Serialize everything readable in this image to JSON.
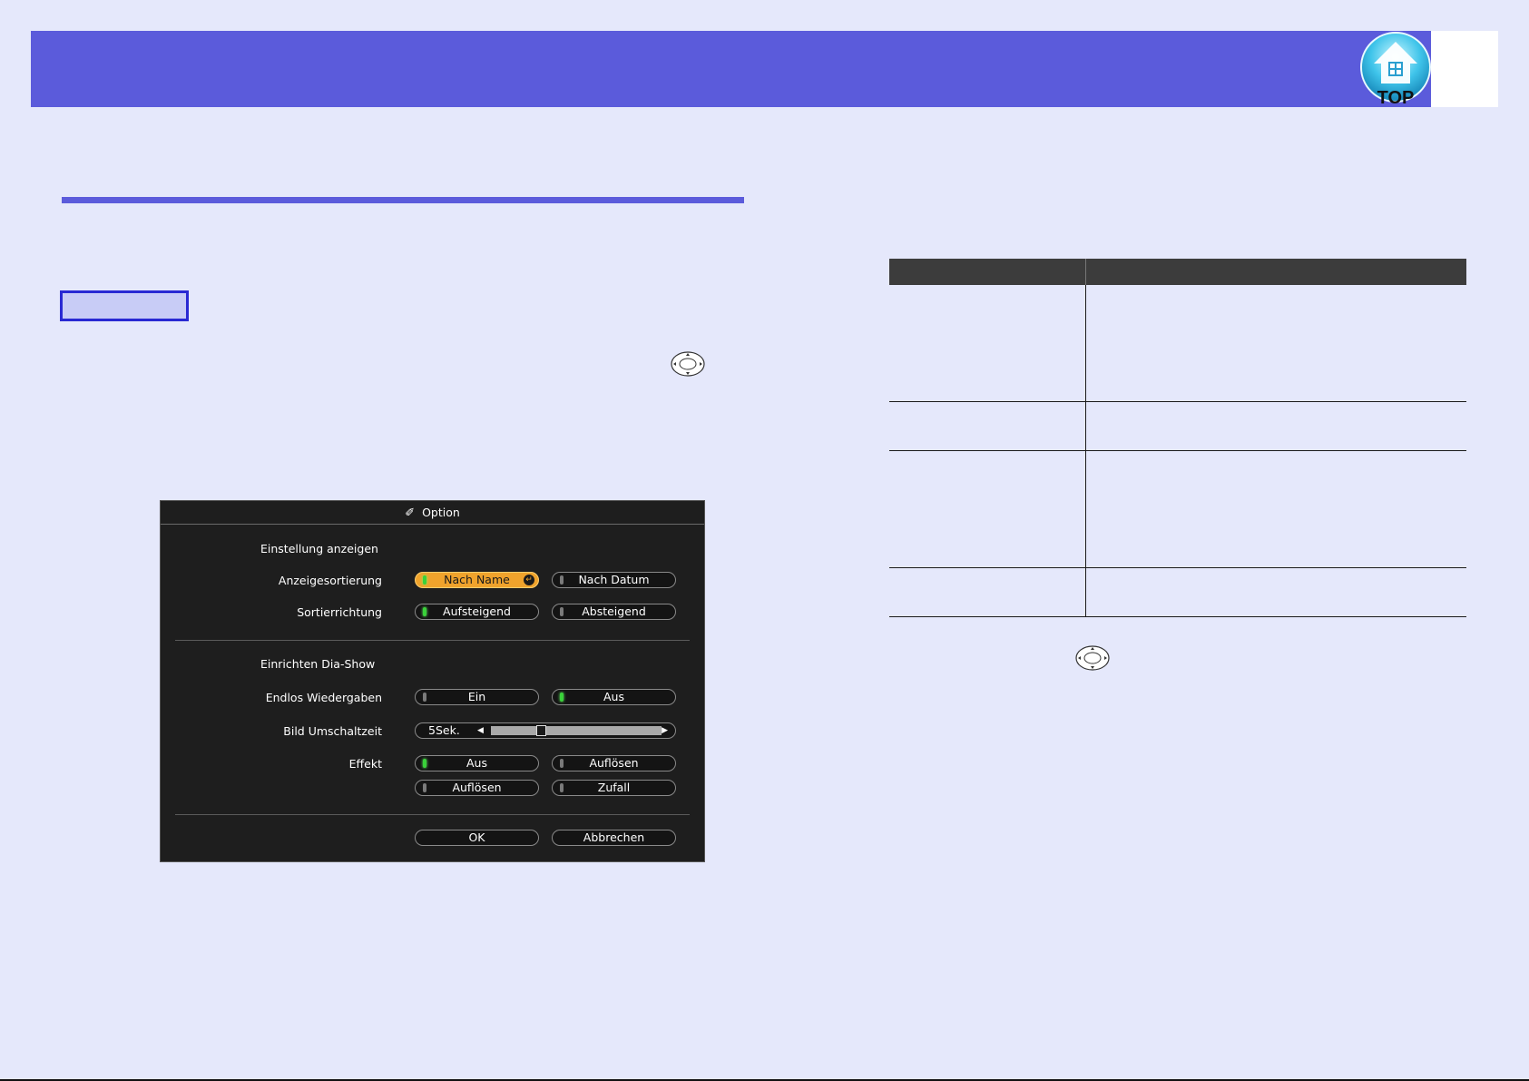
{
  "header": {
    "top_badge_label": "TOP"
  },
  "dialog": {
    "title": "Option",
    "section_display": "Einstellung anzeigen",
    "sort_order": {
      "label": "Anzeigesortierung",
      "options": [
        "Nach Name",
        "Nach Datum"
      ],
      "selected": "Nach Name"
    },
    "sort_direction": {
      "label": "Sortierrichtung",
      "options": [
        "Aufsteigend",
        "Absteigend"
      ],
      "selected": "Aufsteigend"
    },
    "section_slideshow": "Einrichten Dia-Show",
    "loop_playback": {
      "label": "Endlos Wiedergaben",
      "options": [
        "Ein",
        "Aus"
      ],
      "selected": "Aus"
    },
    "switch_time": {
      "label": "Bild Umschaltzeit",
      "value": "5Sek.",
      "level": 0.28
    },
    "effect": {
      "label": "Effekt",
      "options": [
        "Aus",
        "Auflösen",
        "Auflösen",
        "Zufall"
      ],
      "selected": "Aus"
    },
    "ok_label": "OK",
    "cancel_label": "Abbrechen"
  },
  "icons": {
    "top_badge": "house-top-icon",
    "remote_nav": "directional-pad-icon",
    "option_title": "wrench-icon"
  },
  "colors": {
    "header": "#5b5bdb",
    "page_background": "#e5e8fb",
    "selected_option": "#f0a32c",
    "led_on": "#3ad23a"
  }
}
